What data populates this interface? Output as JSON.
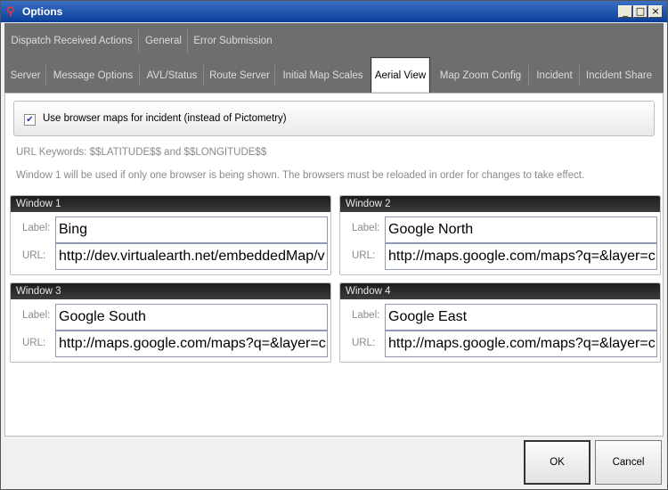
{
  "window": {
    "title": "Options",
    "app_icon": "fork-icon"
  },
  "title_controls": {
    "minimize": "_",
    "maximize": "□",
    "close": "×"
  },
  "tabs_row1": [
    "Dispatch Received Actions",
    "General",
    "Error Submission"
  ],
  "tabs_row2": [
    "Server",
    "Message Options",
    "AVL/Status",
    "Route Server",
    "Initial Map Scales",
    "Aerial View",
    "Map Zoom Config",
    "Incident",
    "Incident Share"
  ],
  "active_tab": "Aerial View",
  "checkbox": {
    "label": "Use browser maps for incident (instead of Pictometry)",
    "checked": true,
    "mark": "✔"
  },
  "info": {
    "keywords": "URL Keywords: $$LATITUDE$$ and $$LONGITUDE$$",
    "note": "Window 1 will be used if only one browser is being shown. The browsers must be reloaded in order for changes to take effect."
  },
  "field_labels": {
    "label": "Label:",
    "url": "URL:"
  },
  "windows": [
    {
      "title": "Window 1",
      "label": "Bing",
      "url": "http://dev.virtualearth.net/embeddedMap/v"
    },
    {
      "title": "Window 2",
      "label": "Google North",
      "url": "http://maps.google.com/maps?q=&layer=c"
    },
    {
      "title": "Window 3",
      "label": "Google South",
      "url": "http://maps.google.com/maps?q=&layer=c"
    },
    {
      "title": "Window 4",
      "label": "Google East",
      "url": "http://maps.google.com/maps?q=&layer=c"
    }
  ],
  "buttons": {
    "ok": "OK",
    "cancel": "Cancel"
  }
}
